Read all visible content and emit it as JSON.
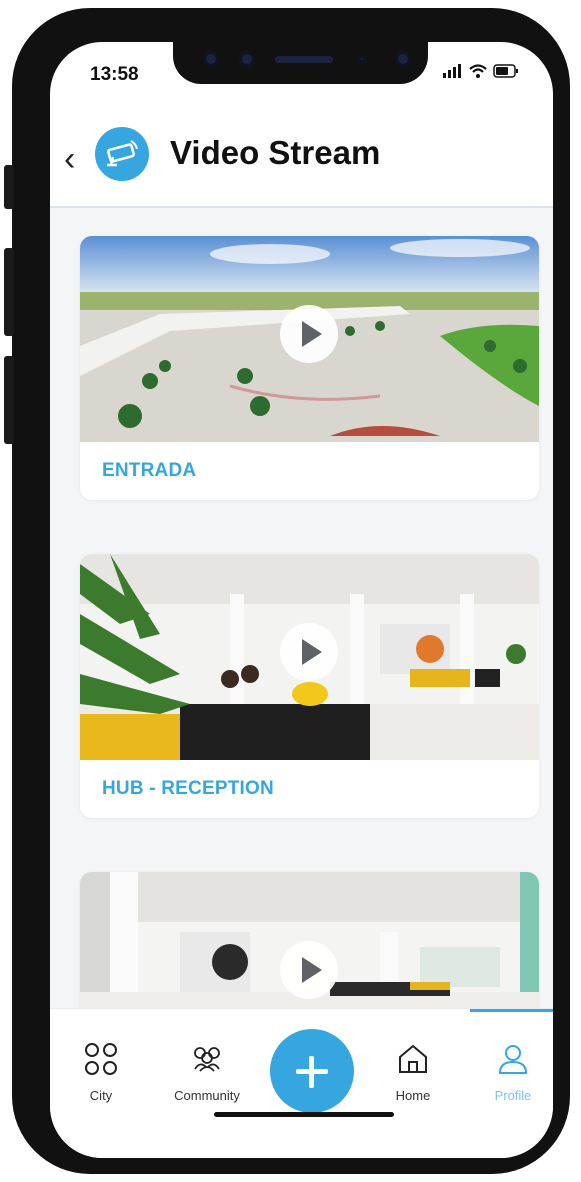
{
  "status_bar": {
    "time": "13:58"
  },
  "header": {
    "title": "Video Stream"
  },
  "streams": [
    {
      "label": "ENTRADA"
    },
    {
      "label": "HUB - RECEPTION"
    },
    {
      "label": ""
    }
  ],
  "tabbar": {
    "tabs": [
      {
        "label": "City",
        "icon": "grid-circles-icon"
      },
      {
        "label": "Community",
        "icon": "people-icon"
      },
      {
        "label": "Home",
        "icon": "house-icon"
      },
      {
        "label": "Profile",
        "icon": "user-icon",
        "active": true
      }
    ],
    "fab_icon": "plus-icon"
  },
  "colors": {
    "accent": "#35a6e0",
    "active_tab": "#7fc3ea",
    "background": "#f4f5f7"
  }
}
